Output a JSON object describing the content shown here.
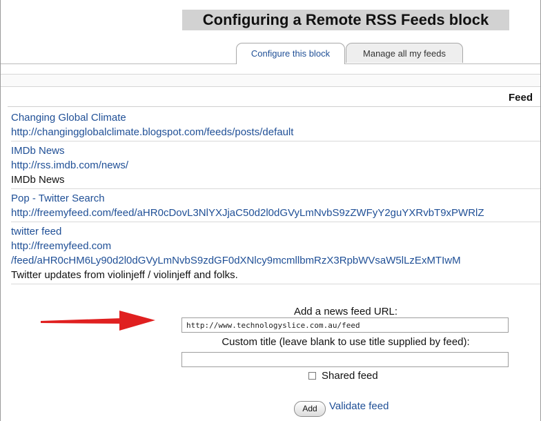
{
  "title": "Configuring a Remote RSS Feeds block",
  "tabs": [
    {
      "label": "Configure this block"
    },
    {
      "label": "Manage all my feeds"
    }
  ],
  "table": {
    "header": "Feed"
  },
  "feeds": [
    {
      "title": "Changing Global Climate",
      "url": "http://changingglobalclimate.blogspot.com/feeds/posts/default",
      "description": ""
    },
    {
      "title": "IMDb News",
      "url": "http://rss.imdb.com/news/",
      "description": "IMDb News"
    },
    {
      "title": "Pop - Twitter Search",
      "url": "http://freemyfeed.com/feed/aHR0cDovL3NlYXJjaC50d2l0dGVyLmNvbS9zZWFyY2guYXRvbT9xPWRlZ",
      "description": ""
    },
    {
      "title": "twitter feed",
      "url": "http://freemyfeed.com",
      "url2": "/feed/aHR0cHM6Ly90d2l0dGVyLmNvbS9zdGF0dXNlcy9mcmllbmRzX3RpbWVsaW5lLzExMTIwM",
      "description": "Twitter updates from violinjeff / violinjeff and folks."
    }
  ],
  "form": {
    "url_label": "Add a news feed URL:",
    "url_value": "http://www.technologyslice.com.au/feed",
    "title_label": "Custom title (leave blank to use title supplied by feed):",
    "title_value": "",
    "shared_label": "Shared feed",
    "shared_checked": false,
    "add_label": "Add",
    "validate_label": "Validate feed"
  },
  "colors": {
    "link": "#1f4f96",
    "arrow": "#e02020",
    "title_bg": "#d2d2d2"
  }
}
